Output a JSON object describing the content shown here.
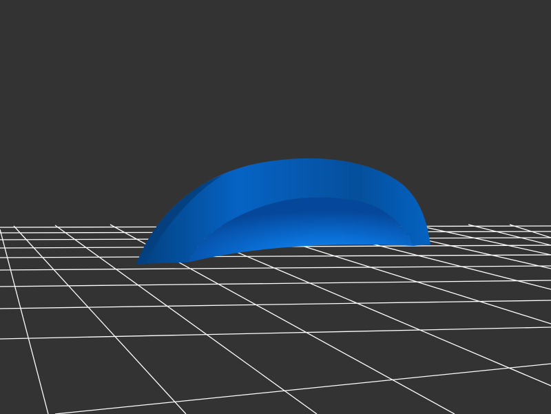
{
  "scene": {
    "background_color": "#333333",
    "grid_color": "#ffffff",
    "object": {
      "shape": "half-dome-shell",
      "color_light": "#0a7ae6",
      "color_mid": "#0662c2",
      "color_dark": "#033f7d"
    }
  }
}
